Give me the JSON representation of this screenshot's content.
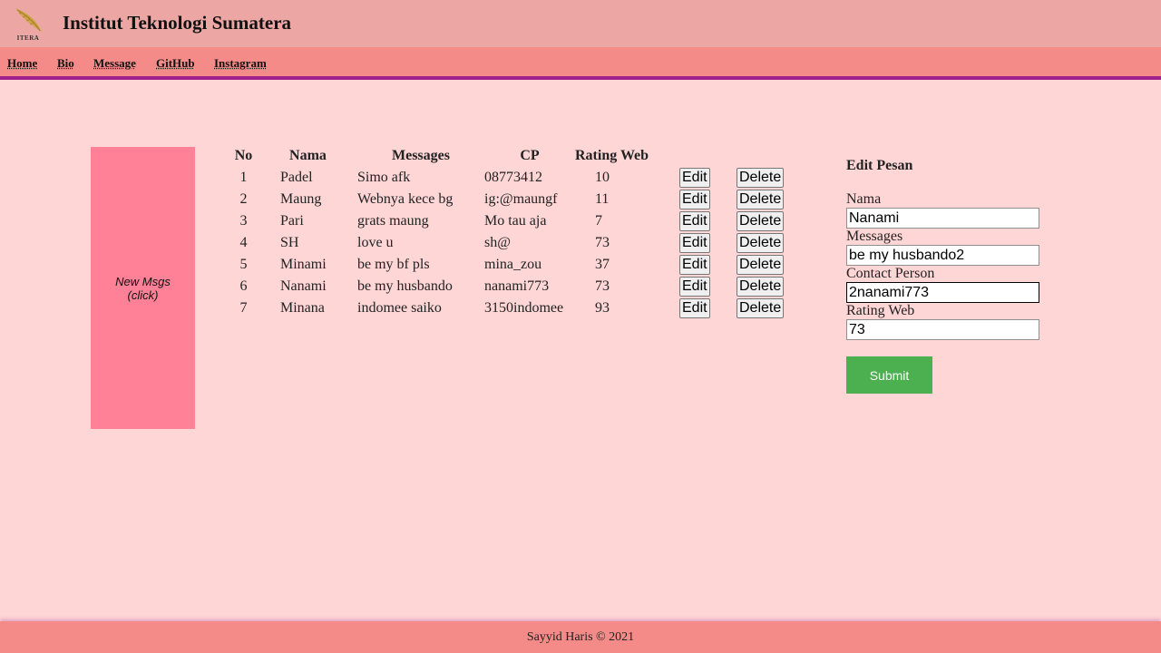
{
  "header": {
    "logo_text": "ITERA",
    "title": "Institut Teknologi Sumatera"
  },
  "nav": {
    "items": [
      "Home",
      "Bio",
      "Message",
      "GitHub",
      "Instagram"
    ]
  },
  "new_msg": {
    "line1": "New Msgs",
    "line2": "(click)"
  },
  "table": {
    "headers": [
      "No",
      "Nama",
      "Messages",
      "CP",
      "Rating Web"
    ],
    "edit_label": "Edit",
    "delete_label": "Delete",
    "rows": [
      {
        "no": "1",
        "nama": "Padel",
        "message": "Simo afk",
        "cp": "08773412",
        "rating": "10"
      },
      {
        "no": "2",
        "nama": "Maung",
        "message": "Webnya kece bg",
        "cp": "ig:@maungf",
        "rating": "11"
      },
      {
        "no": "3",
        "nama": "Pari",
        "message": "grats maung",
        "cp": "Mo tau aja",
        "rating": "7"
      },
      {
        "no": "4",
        "nama": "SH",
        "message": "love u",
        "cp": "sh@",
        "rating": "73"
      },
      {
        "no": "5",
        "nama": "Minami",
        "message": "be my bf pls",
        "cp": "mina_zou",
        "rating": "37"
      },
      {
        "no": "6",
        "nama": "Nanami",
        "message": "be my husbando",
        "cp": "nanami773",
        "rating": "73"
      },
      {
        "no": "7",
        "nama": "Minana",
        "message": "indomee saiko",
        "cp": "3150indomee",
        "rating": "93"
      }
    ]
  },
  "form": {
    "title": "Edit Pesan",
    "nama_label": "Nama",
    "nama_value": "Nanami",
    "messages_label": "Messages",
    "messages_value": "be my husbando2",
    "cp_label": "Contact Person",
    "cp_value": "2nanami773",
    "rating_label": "Rating Web",
    "rating_value": "73",
    "submit_label": "Submit"
  },
  "footer": {
    "text": "Sayyid Haris © 2021"
  },
  "colors": {
    "background": "#ffd6d6",
    "header": "#eca7a5",
    "nav": "#f48b88",
    "nav_border": "#a0208e",
    "new_msg_box": "#ff8198",
    "submit": "#4caf50"
  }
}
